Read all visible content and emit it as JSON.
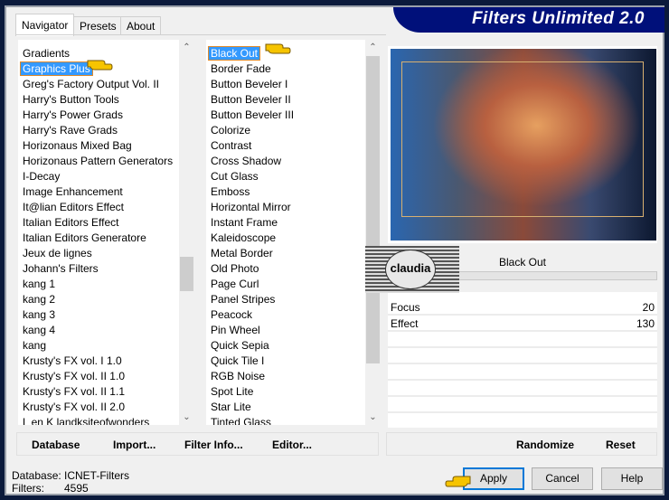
{
  "app": {
    "title": "Filters Unlimited 2.0"
  },
  "tabs": [
    {
      "label": "Navigator"
    },
    {
      "label": "Presets"
    },
    {
      "label": "About"
    }
  ],
  "categories": {
    "selected": "Graphics Plus",
    "items": [
      "Gradients",
      "Graphics Plus",
      "Greg's Factory Output Vol. II",
      "Harry's Button Tools",
      "Harry's Power Grads",
      "Harry's Rave Grads",
      "Horizonaus Mixed Bag",
      "Horizonaus Pattern Generators",
      "I-Decay",
      "Image Enhancement",
      "It@lian Editors Effect",
      "Italian Editors Effect",
      "Italian Editors Generatore",
      "Jeux de lignes",
      "Johann's Filters",
      "kang 1",
      "kang 2",
      "kang 3",
      "kang 4",
      "kang",
      "Krusty's FX vol. I 1.0",
      "Krusty's FX vol. II 1.0",
      "Krusty's FX vol. II 1.1",
      "Krusty's FX vol. II 2.0",
      "L en K landksiteofwonders"
    ]
  },
  "filters": {
    "selected": "Black Out",
    "items": [
      "Black Out",
      "Border Fade",
      "Button Beveler I",
      "Button Beveler II",
      "Button Beveler III",
      "Colorize",
      "Contrast",
      "Cross Shadow",
      "Cut Glass",
      "Emboss",
      "Horizontal Mirror",
      "Instant Frame",
      "Kaleidoscope",
      "Metal Border",
      "Old Photo",
      "Page Curl",
      "Panel Stripes",
      "Peacock",
      "Pin Wheel",
      "Quick Sepia",
      "Quick Tile I",
      "RGB Noise",
      "Spot Lite",
      "Star Lite",
      "Tinted Glass"
    ]
  },
  "controls": {
    "filter_name": "Black Out",
    "params": [
      {
        "label": "Focus",
        "value": "20"
      },
      {
        "label": "Effect",
        "value": "130"
      }
    ]
  },
  "buttons": {
    "database": "Database",
    "import": "Import...",
    "filter_info": "Filter Info...",
    "editor": "Editor...",
    "randomize": "Randomize",
    "reset": "Reset",
    "apply": "Apply",
    "cancel": "Cancel",
    "help": "Help"
  },
  "status": {
    "database_label": "Database:",
    "database_value": "ICNET-Filters",
    "filters_label": "Filters:",
    "filters_value": "4595"
  },
  "watermark": "claudia",
  "colors": {
    "selection": "#3399ff",
    "banner": "#00107a"
  }
}
